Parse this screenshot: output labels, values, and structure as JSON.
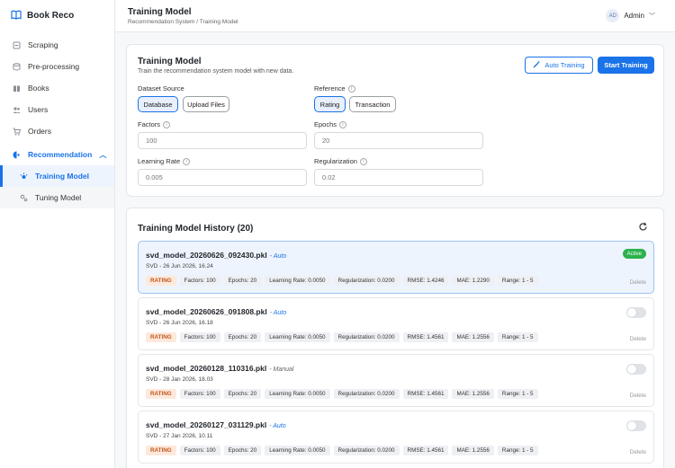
{
  "app": {
    "brand": "Book Reco"
  },
  "sidebar": {
    "items": [
      {
        "label": "Scraping",
        "icon": "scraping-icon"
      },
      {
        "label": "Pre-processing",
        "icon": "database-icon"
      },
      {
        "label": "Books",
        "icon": "book-icon"
      },
      {
        "label": "Users",
        "icon": "users-icon"
      },
      {
        "label": "Orders",
        "icon": "cart-icon"
      }
    ],
    "section": {
      "label": "Recommendation",
      "icon": "recommendation-icon"
    },
    "subitems": [
      {
        "label": "Training Model",
        "icon": "training-icon",
        "active": true
      },
      {
        "label": "Tuning Model",
        "icon": "tuning-icon",
        "active": false
      }
    ]
  },
  "header": {
    "title": "Training Model",
    "breadcrumb": [
      "Recommendation System",
      "Training Model"
    ],
    "breadcrumb_sep": "/",
    "user": {
      "initials": "AD",
      "name": "Admin"
    }
  },
  "training": {
    "title": "Training Model",
    "subtitle": "Train the recommendation system model with new data.",
    "auto_label": "Auto Training",
    "start_label": "Start Training",
    "dataset_label": "Dataset Source",
    "dataset_options": [
      "Database",
      "Upload Files"
    ],
    "dataset_selected": "Database",
    "reference_label": "Reference",
    "reference_options": [
      "Rating",
      "Transaction"
    ],
    "reference_selected": "Rating",
    "factors_label": "Factors",
    "factors_placeholder": "100",
    "epochs_label": "Epochs",
    "epochs_placeholder": "20",
    "lr_label": "Learning Rate",
    "lr_placeholder": "0.005",
    "reg_label": "Regularization",
    "reg_placeholder": "0.02"
  },
  "history": {
    "title": "Training Model History (20)",
    "active_label": "Active",
    "delete_label": "Delete",
    "rows": [
      {
        "name": "svd_model_20260626_092430.pkl",
        "mode": "- Auto",
        "meta": "SVD - 26 Jun 2026, 16.24",
        "active": true,
        "tags": [
          "RATING",
          "Factors: 100",
          "Epochs: 20",
          "Learning Rate: 0.0050",
          "Regularization: 0.0200",
          "RMSE: 1.4246",
          "MAE: 1.2290",
          "Range: 1 - 5"
        ]
      },
      {
        "name": "svd_model_20260626_091808.pkl",
        "mode": "- Auto",
        "meta": "SVD - 26 Jun 2026, 16.18",
        "active": false,
        "tags": [
          "RATING",
          "Factors: 100",
          "Epochs: 20",
          "Learning Rate: 0.0050",
          "Regularization: 0.0200",
          "RMSE: 1.4561",
          "MAE: 1.2556",
          "Range: 1 - 5"
        ]
      },
      {
        "name": "svd_model_20260128_110316.pkl",
        "mode": "- Manual",
        "meta": "SVD - 28 Jan 2026, 18.03",
        "active": false,
        "tags": [
          "RATING",
          "Factors: 100",
          "Epochs: 20",
          "Learning Rate: 0.0050",
          "Regularization: 0.0200",
          "RMSE: 1.4561",
          "MAE: 1.2556",
          "Range: 1 - 5"
        ]
      },
      {
        "name": "svd_model_20260127_031129.pkl",
        "mode": "- Auto",
        "meta": "SVD - 27 Jan 2026, 10.11",
        "active": false,
        "tags": [
          "RATING",
          "Factors: 100",
          "Epochs: 20",
          "Learning Rate: 0.0050",
          "Regularization: 0.0200",
          "RMSE: 1.4561",
          "MAE: 1.2556",
          "Range: 1 - 5"
        ]
      }
    ]
  },
  "colors": {
    "accent": "#1a73e8",
    "active_badge": "#2bb24c",
    "rating_tag_bg": "#fde9dc",
    "rating_tag_text": "#c2561b"
  }
}
